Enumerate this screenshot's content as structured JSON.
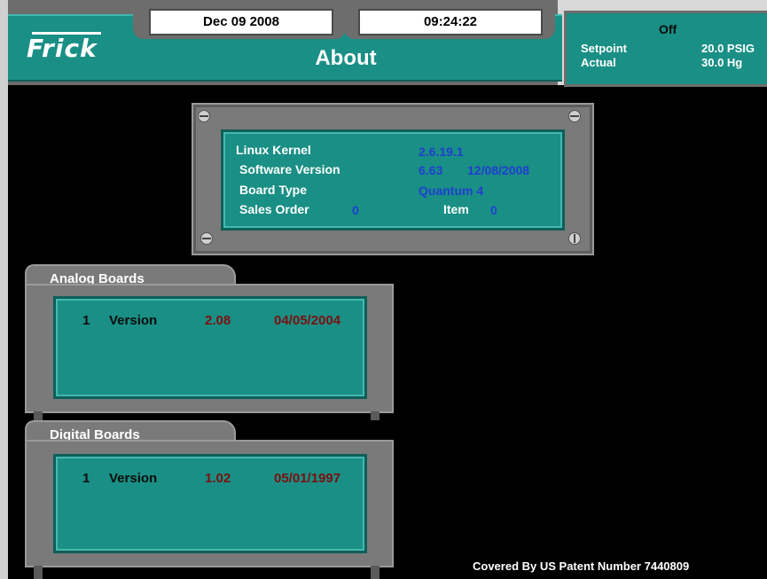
{
  "header": {
    "date": "Dec 09 2008",
    "time": "09:24:22",
    "logo": "Frick",
    "title": "About"
  },
  "status": {
    "state": "Off",
    "setpoint_label": "Setpoint",
    "setpoint_value": "20.0 PSIG",
    "actual_label": "Actual",
    "actual_value": "30.0 Hg"
  },
  "about": {
    "linux_kernel_label": "Linux Kernel",
    "linux_kernel_value": "2.6.19.1",
    "software_version_label": "Software Version",
    "software_version_value": "6.63",
    "software_version_date": "12/08/2008",
    "board_type_label": "Board Type",
    "board_type_value": "Quantum 4",
    "sales_order_label": "Sales Order",
    "sales_order_value": "0",
    "item_label": "Item",
    "item_value": "0"
  },
  "analog_boards": {
    "title": "Analog Boards",
    "rows": [
      {
        "number": "1",
        "label": "Version",
        "version": "2.08",
        "date": "04/05/2004"
      }
    ]
  },
  "digital_boards": {
    "title": "Digital Boards",
    "rows": [
      {
        "number": "1",
        "label": "Version",
        "version": "1.02",
        "date": "05/01/1997"
      }
    ]
  },
  "footer": {
    "patent": "Covered By US Patent Number 7440809"
  },
  "colors": {
    "teal": "#1a8f85",
    "panel_gray": "#7a7a7a",
    "value_blue": "#1f3fd0",
    "value_red": "#7a1010"
  }
}
